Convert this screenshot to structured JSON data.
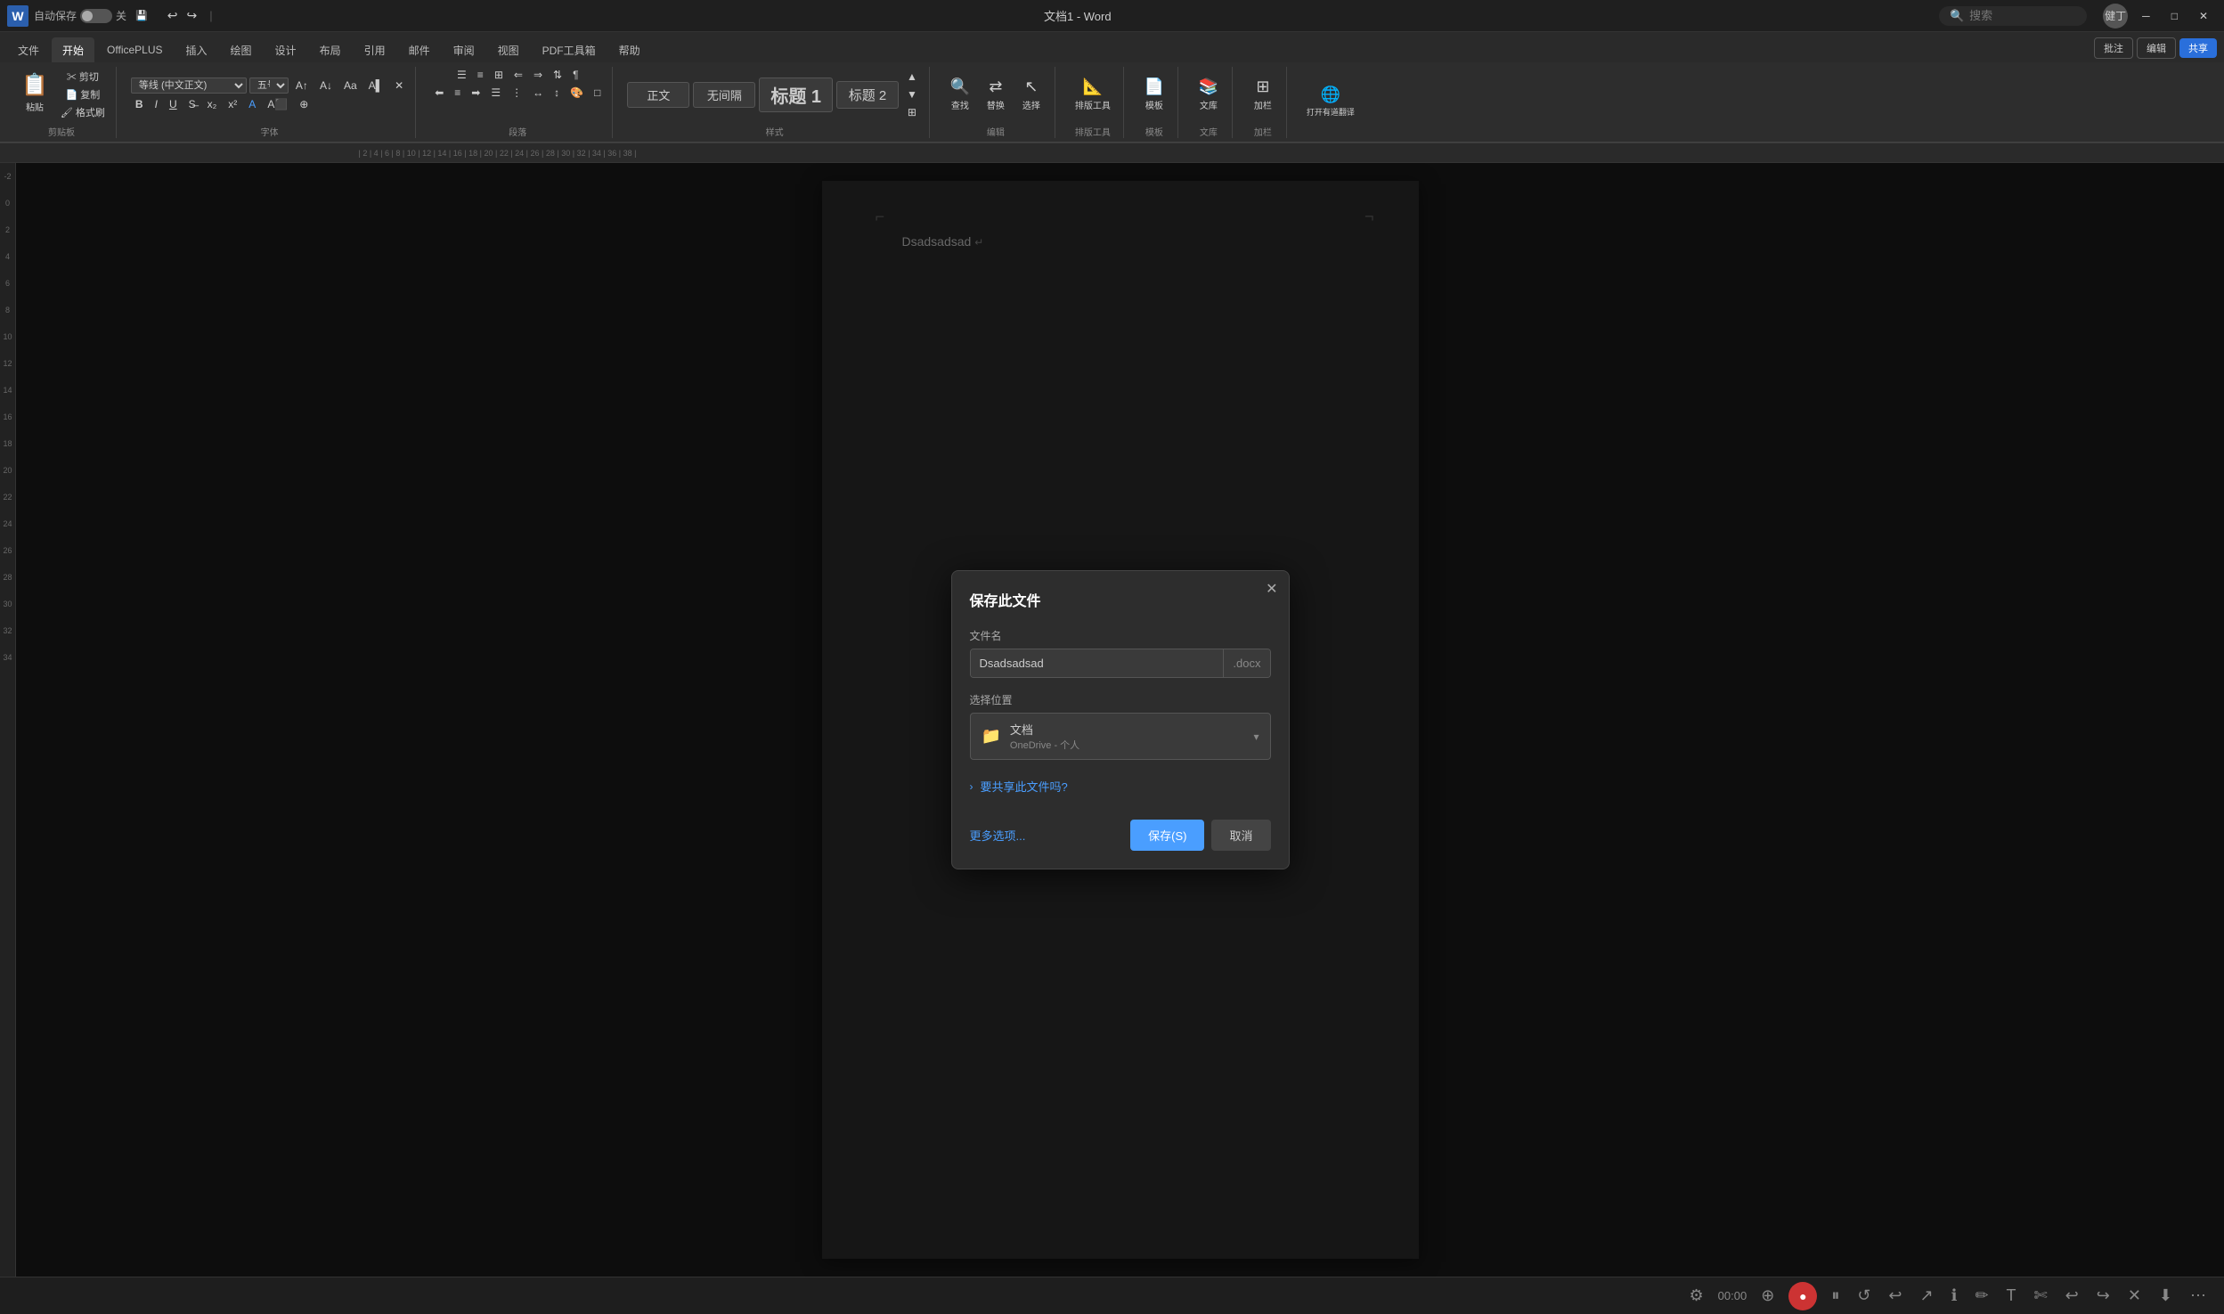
{
  "titleBar": {
    "appIcon": "W",
    "autosave": "自动保存",
    "autosaveStatus": "关",
    "saveIcon": "💾",
    "undoIcon": "↩",
    "redoIcon": "↪",
    "separator": "|",
    "fileName": "文档1 - Word",
    "searchPlaceholder": "搜索",
    "userName": "健丁",
    "minimizeBtn": "─",
    "restoreBtn": "□",
    "closeBtn": "✕"
  },
  "ribbon": {
    "tabs": [
      "文件",
      "开始",
      "OfficePLUS",
      "插入",
      "绘图",
      "设计",
      "布局",
      "引用",
      "邮件",
      "审阅",
      "视图",
      "PDF工具箱",
      "帮助"
    ],
    "activeTab": "开始",
    "groups": {
      "clipboard": {
        "label": "剪贴板",
        "pasteBtn": "粘贴",
        "cutBtn": "剪切",
        "copyBtn": "复制",
        "formatPaintBtn": "格式刷"
      },
      "font": {
        "label": "字体",
        "fontName": "等线 (中文正文)",
        "fontSize": "五号",
        "boldBtn": "B",
        "italicBtn": "I",
        "underlineBtn": "U",
        "strikeBtn": "S",
        "subBtn": "x₂",
        "superBtn": "x²"
      },
      "paragraph": {
        "label": "段落"
      },
      "styles": {
        "label": "样式",
        "items": [
          "正文",
          "无间隔",
          "标题 1",
          "标题 2"
        ]
      },
      "editing": {
        "label": "编辑",
        "findBtn": "查找",
        "replaceBtn": "替换",
        "selectBtn": "选择"
      },
      "typesettingTools": {
        "label": "排版工具"
      },
      "templates": {
        "label": "模板"
      },
      "library": {
        "label": "文库"
      },
      "addColumn": {
        "label": "加栏"
      },
      "openTranslate": {
        "label": "打开有道翻译"
      }
    },
    "rightButtons": {
      "comments": "批注",
      "edit": "编辑",
      "share": "共享"
    }
  },
  "ruler": {
    "marks": [
      "|2|",
      "|4|",
      "|6|",
      "|8|",
      "|10|",
      "|12|",
      "|14|",
      "|16|",
      "|18|",
      "|20|",
      "|22|",
      "|24|",
      "|26|",
      "|28|",
      "|30|",
      "|32|",
      "|34|",
      "|36|",
      "|38|"
    ]
  },
  "document": {
    "content": "Dsadsadsad",
    "cursorMark": "↵"
  },
  "saveDialog": {
    "title": "保存此文件",
    "closeBtn": "✕",
    "fileNameLabel": "文件名",
    "fileNameValue": "Dsadsadsad",
    "fileExt": ".docx",
    "locationLabel": "选择位置",
    "locationName": "文档",
    "locationSub": "OneDrive - 个人",
    "shareText": "要共享此文件吗?",
    "moreOptions": "更多选项...",
    "saveBtn": "保存(S)",
    "cancelBtn": "取消"
  },
  "bottomBar": {
    "settingsIcon": "⚙",
    "timer": "00:00",
    "expandIcon": "⊕",
    "recordIcon": "●",
    "pauseIcon": "⏸",
    "refreshIcon": "↺",
    "undoIcon": "↩",
    "arrowIcon": "↗",
    "infoIcon": "ℹ",
    "penIcon": "✏",
    "tIcon": "T",
    "scissorsIcon": "✄",
    "undoIcon2": "↩",
    "redoIcon2": "↪",
    "closeIcon": "✕",
    "downloadIcon": "⬇",
    "moreIcon": "⋯"
  },
  "sideRuler": {
    "marks": [
      "-2",
      "0",
      "2",
      "4",
      "6",
      "8",
      "10",
      "12",
      "14",
      "16",
      "18",
      "20",
      "22",
      "24",
      "26",
      "28",
      "30",
      "32",
      "34"
    ]
  }
}
